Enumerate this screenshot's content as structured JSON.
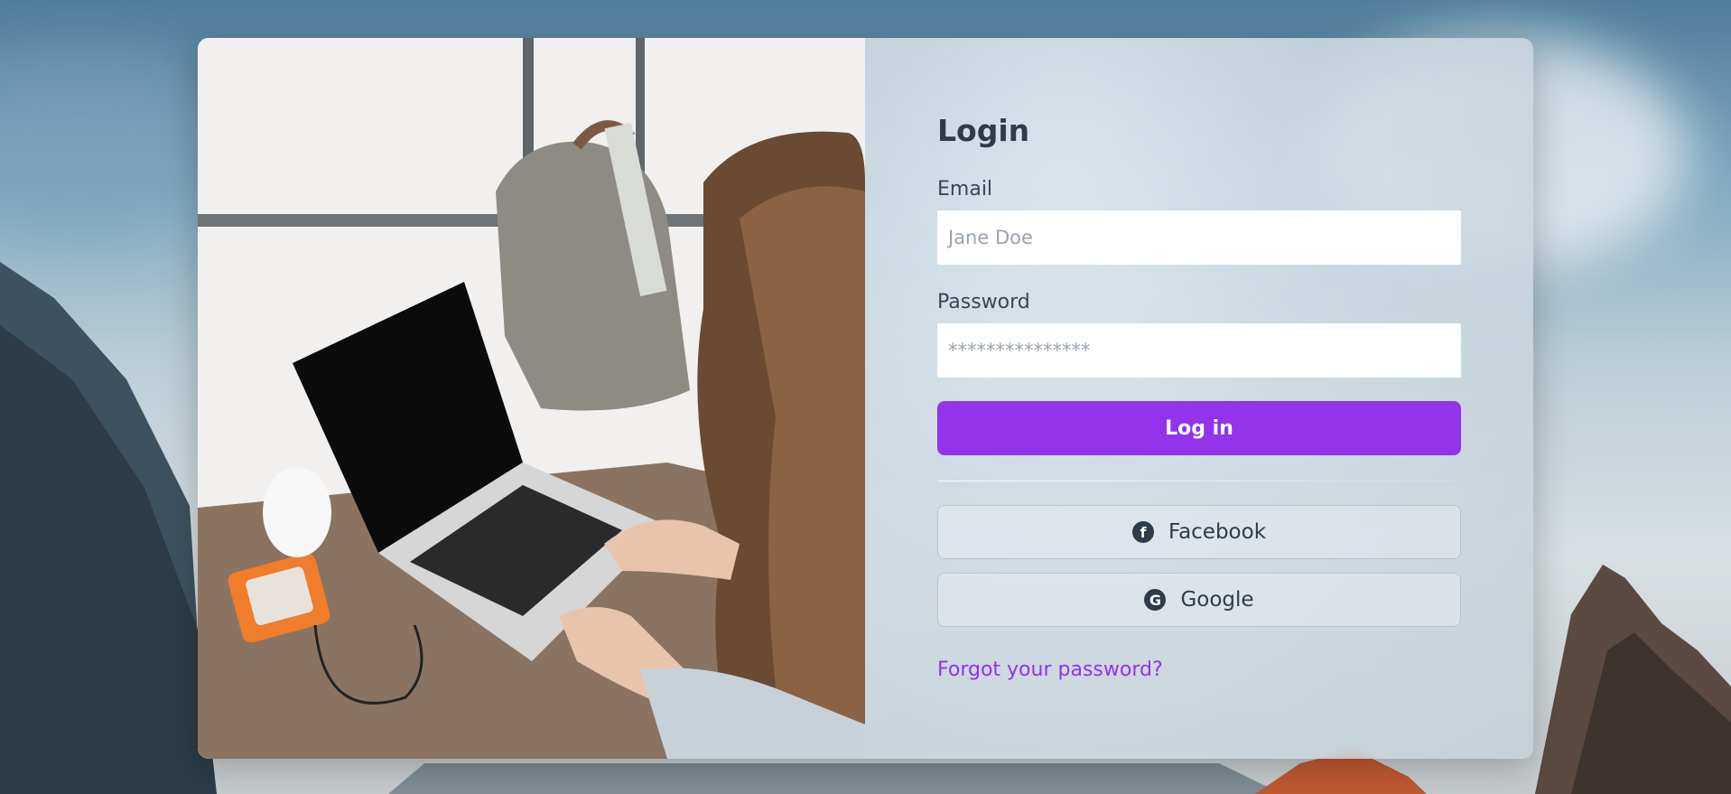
{
  "login": {
    "title": "Login",
    "email_label": "Email",
    "email_placeholder": "Jane Doe",
    "password_label": "Password",
    "password_placeholder": "***************",
    "submit_label": "Log in",
    "facebook_label": "Facebook",
    "google_label": "Google",
    "forgot_label": "Forgot your password?"
  },
  "icons": {
    "facebook": "facebook-icon",
    "google": "google-icon"
  },
  "colors": {
    "accent": "#9333ea",
    "text": "#2f3b4a"
  }
}
